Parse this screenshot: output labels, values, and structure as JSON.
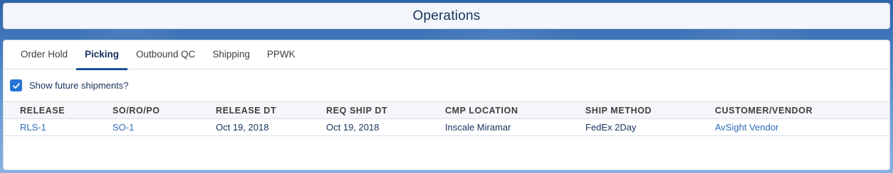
{
  "header": {
    "title": "Operations"
  },
  "tabs": [
    {
      "label": "Order Hold",
      "active": false
    },
    {
      "label": "Picking",
      "active": true
    },
    {
      "label": "Outbound QC",
      "active": false
    },
    {
      "label": "Shipping",
      "active": false
    },
    {
      "label": "PPWK",
      "active": false
    }
  ],
  "filter": {
    "label": "Show future shipments?",
    "checked": true
  },
  "table": {
    "columns": [
      "RELEASE",
      "SO/RO/PO",
      "RELEASE DT",
      "REQ SHIP DT",
      "CMP LOCATION",
      "SHIP METHOD",
      "CUSTOMER/VENDOR"
    ],
    "rows": [
      {
        "release": "RLS-1",
        "order": "SO-1",
        "release_dt": "Oct 19, 2018",
        "req_ship_dt": "Oct 19, 2018",
        "cmp_location": "Inscale Miramar",
        "ship_method": "FedEx 2Day",
        "customer_vendor": "AvSight Vendor"
      }
    ]
  },
  "colors": {
    "accent": "#1b5297",
    "link": "#2d6bb8",
    "checkbox": "#2474d4"
  }
}
